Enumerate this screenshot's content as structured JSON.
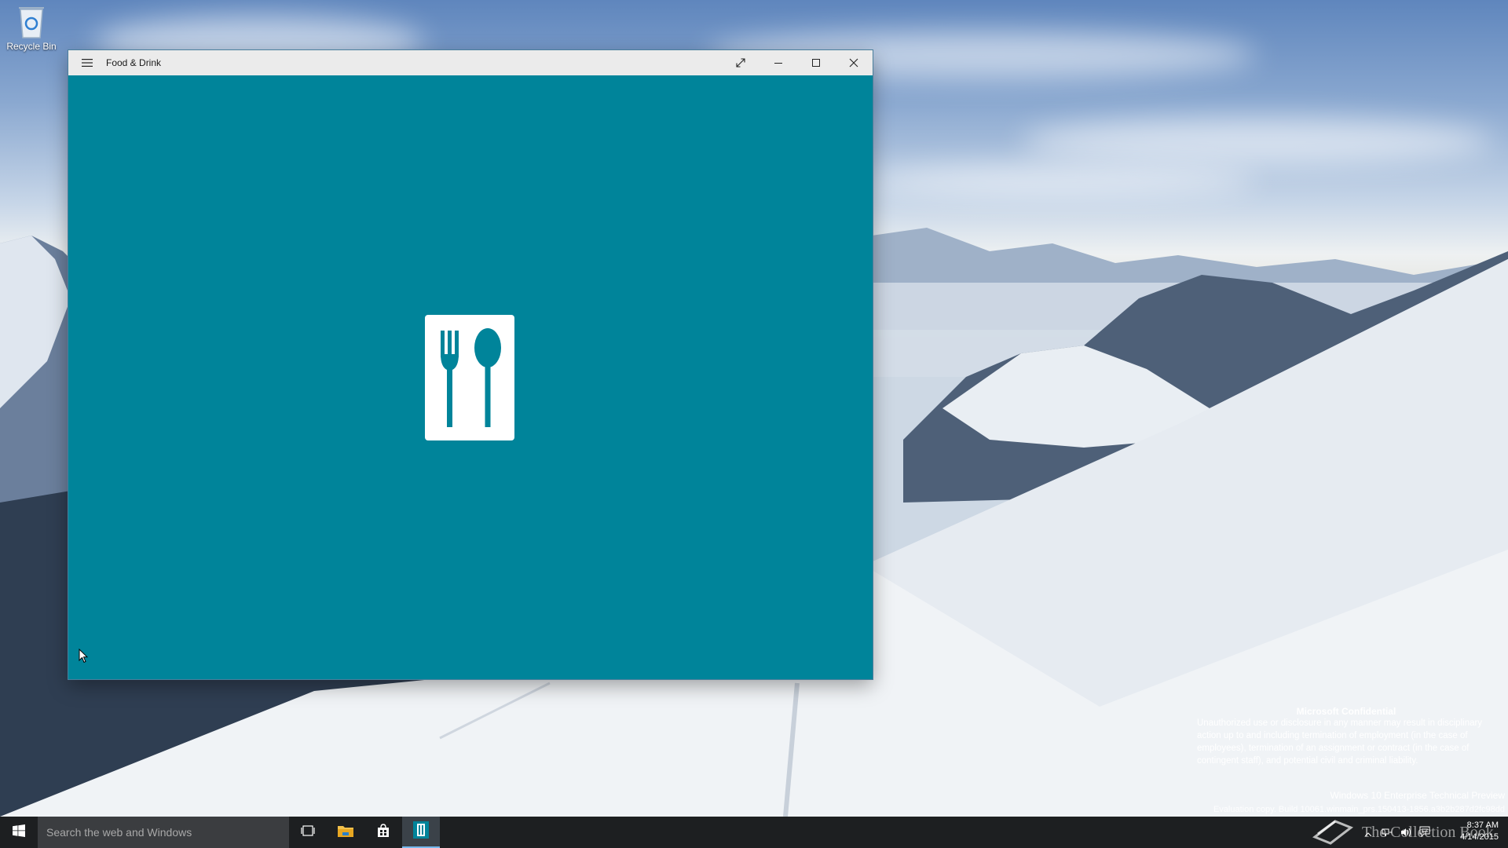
{
  "desktop": {
    "icons": [
      {
        "label": "Recycle Bin",
        "icon": "recycle-bin-icon"
      }
    ]
  },
  "window": {
    "title": "Food & Drink",
    "menu_icon": "hamburger-menu-icon",
    "controls": {
      "fullscreen_icon": "full-screen-icon",
      "minimize_icon": "minimize-icon",
      "maximize_icon": "maximize-icon",
      "close_icon": "close-icon"
    },
    "splash": {
      "background_color": "#00849a",
      "logo_icon": "fork-and-spoon-icon",
      "logo_color": "#ffffff"
    }
  },
  "watermark": {
    "title": "Microsoft Confidential",
    "lines": [
      "Unauthorized use or disclosure in any manner may result in disciplinary",
      "action up to and including termination of employment (in the case of",
      "employees), termination of an assignment or contract (in the case of",
      "contingent staff), and potential civil and criminal liability."
    ],
    "edition": "Windows 10 Enterprise Technical Preview",
    "build": "Evaluation copy. Build 10061.winmain_prs.150413-1856.a3b2b287d2fc98dd"
  },
  "taskbar": {
    "start_icon": "windows-logo-icon",
    "search_placeholder": "Search the web and Windows",
    "apps": [
      {
        "name": "task-view",
        "icon": "task-view-icon",
        "active": false
      },
      {
        "name": "file-explorer",
        "icon": "folder-icon",
        "active": false
      },
      {
        "name": "store",
        "icon": "store-bag-icon",
        "active": false
      },
      {
        "name": "food-and-drink",
        "icon": "food-and-drink-app-icon",
        "active": true
      }
    ],
    "brand_text": "The Collection Book",
    "tray": {
      "icons": [
        "show-hidden-icons-chevron-icon",
        "network-icon",
        "volume-icon",
        "action-center-icon"
      ],
      "time": "8:37 AM",
      "date": "4/14/2015"
    },
    "accent_color": "#76b9ed"
  }
}
